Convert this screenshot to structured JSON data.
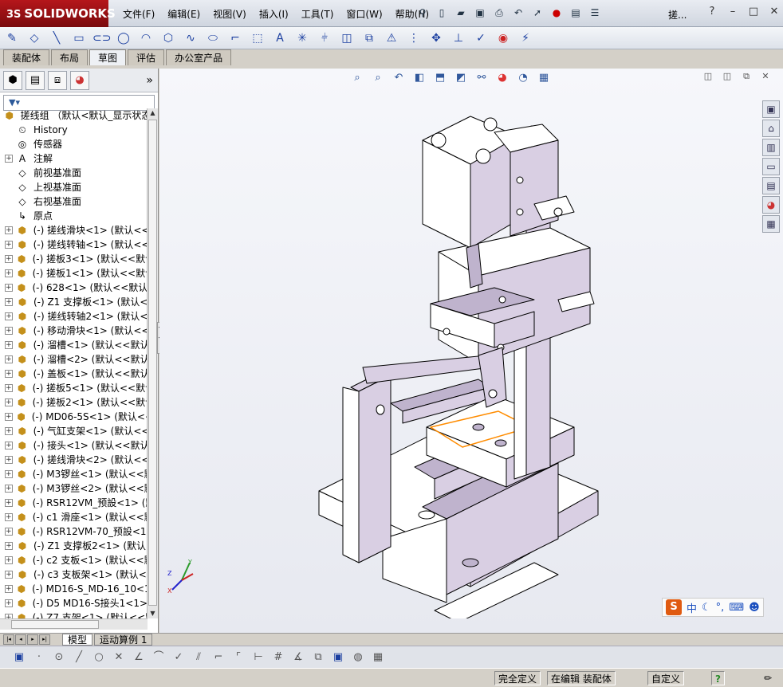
{
  "app": {
    "logo_ds": "3S",
    "logo_name": "SOLIDWORKS",
    "doc_title": "搓..."
  },
  "menu": [
    "文件(F)",
    "编辑(E)",
    "视图(V)",
    "插入(I)",
    "工具(T)",
    "窗口(W)",
    "帮助(H)"
  ],
  "command_tabs": [
    {
      "label": "装配体",
      "active": false
    },
    {
      "label": "布局",
      "active": false
    },
    {
      "label": "草图",
      "active": true
    },
    {
      "label": "评估",
      "active": false
    },
    {
      "label": "办公室产品",
      "active": false
    }
  ],
  "tree": {
    "root": "搓线组 （默认<默认_显示状态",
    "nodes": [
      {
        "label": "History",
        "icon": "history-icon",
        "expandable": false
      },
      {
        "label": "传感器",
        "icon": "sensor-icon",
        "expandable": false
      },
      {
        "label": "注解",
        "icon": "annotation-icon",
        "expandable": true
      },
      {
        "label": "前视基准面",
        "icon": "plane-icon",
        "expandable": false
      },
      {
        "label": "上视基准面",
        "icon": "plane-icon",
        "expandable": false
      },
      {
        "label": "右视基准面",
        "icon": "plane-icon",
        "expandable": false
      },
      {
        "label": "原点",
        "icon": "origin-icon",
        "expandable": false
      },
      {
        "label": "(-) 搓线滑块<1> (默认<<",
        "icon": "part-icon",
        "expandable": true
      },
      {
        "label": "(-) 搓线转轴<1> (默认<<",
        "icon": "part-icon",
        "expandable": true
      },
      {
        "label": "(-) 搓板3<1> (默认<<默认",
        "icon": "part-icon",
        "expandable": true
      },
      {
        "label": "(-) 搓板1<1> (默认<<默认",
        "icon": "part-icon",
        "expandable": true
      },
      {
        "label": "(-) 628<1> (默认<<默认>",
        "icon": "part-icon",
        "expandable": true
      },
      {
        "label": "(-) Z1 支撑板<1> (默认<",
        "icon": "part-icon",
        "expandable": true
      },
      {
        "label": "(-) 搓线转轴2<1> (默认<",
        "icon": "part-icon",
        "expandable": true
      },
      {
        "label": "(-) 移动滑块<1> (默认<<",
        "icon": "part-icon",
        "expandable": true
      },
      {
        "label": "(-) 溜槽<1> (默认<<默认",
        "icon": "part-icon",
        "expandable": true
      },
      {
        "label": "(-) 溜槽<2> (默认<<默认",
        "icon": "part-icon",
        "expandable": true
      },
      {
        "label": "(-) 盖板<1> (默认<<默认",
        "icon": "part-icon",
        "expandable": true
      },
      {
        "label": "(-) 搓板5<1> (默认<<默认",
        "icon": "part-icon",
        "expandable": true
      },
      {
        "label": "(-) 搓板2<1> (默认<<默认",
        "icon": "part-icon",
        "expandable": true
      },
      {
        "label": "(-) MD06-5S<1> (默认<<默",
        "icon": "part-icon",
        "expandable": true
      },
      {
        "label": "(-) 气缸支架<1> (默认<<",
        "icon": "part-icon",
        "expandable": true
      },
      {
        "label": "(-) 接头<1> (默认<<默认",
        "icon": "part-icon",
        "expandable": true
      },
      {
        "label": "(-) 搓线滑块<2> (默认<<",
        "icon": "part-icon",
        "expandable": true
      },
      {
        "label": "(-) M3锣丝<1> (默认<<默",
        "icon": "part-icon",
        "expandable": true
      },
      {
        "label": "(-) M3锣丝<2> (默认<<默",
        "icon": "part-icon",
        "expandable": true
      },
      {
        "label": "(-) RSR12VM_预設<1> (默",
        "icon": "part-icon",
        "expandable": true
      },
      {
        "label": "(-) c1 滑座<1> (默认<<默",
        "icon": "part-icon",
        "expandable": true
      },
      {
        "label": "(-) RSR12VM-70_预設<1>",
        "icon": "part-icon",
        "expandable": true
      },
      {
        "label": "(-) Z1 支撑板2<1> (默认",
        "icon": "part-icon",
        "expandable": true
      },
      {
        "label": "(-) c2 支板<1> (默认<<默",
        "icon": "part-icon",
        "expandable": true
      },
      {
        "label": "(-) c3 支板架<1> (默认<",
        "icon": "part-icon",
        "expandable": true
      },
      {
        "label": "(-) MD16-S_MD-16_10<1>",
        "icon": "part-icon",
        "expandable": true
      },
      {
        "label": "(-) D5 MD16-S接头1<1> (",
        "icon": "part-icon",
        "expandable": true
      },
      {
        "label": "(-) Z7 支架<1> (默认<<默",
        "icon": "part-icon",
        "expandable": true
      }
    ]
  },
  "bottom_tabs": {
    "model": "模型",
    "motion": "运动算例 1"
  },
  "ime": {
    "logo": "S",
    "lang": "中"
  },
  "status": {
    "defined": "完全定义",
    "editing": "在编辑 装配体",
    "units": "自定义"
  },
  "colors": {
    "part_face": "#d9cfe3",
    "part_shadow": "#bfb3cd",
    "selection": "#ff8c00",
    "logo_red": "#b5161b"
  }
}
